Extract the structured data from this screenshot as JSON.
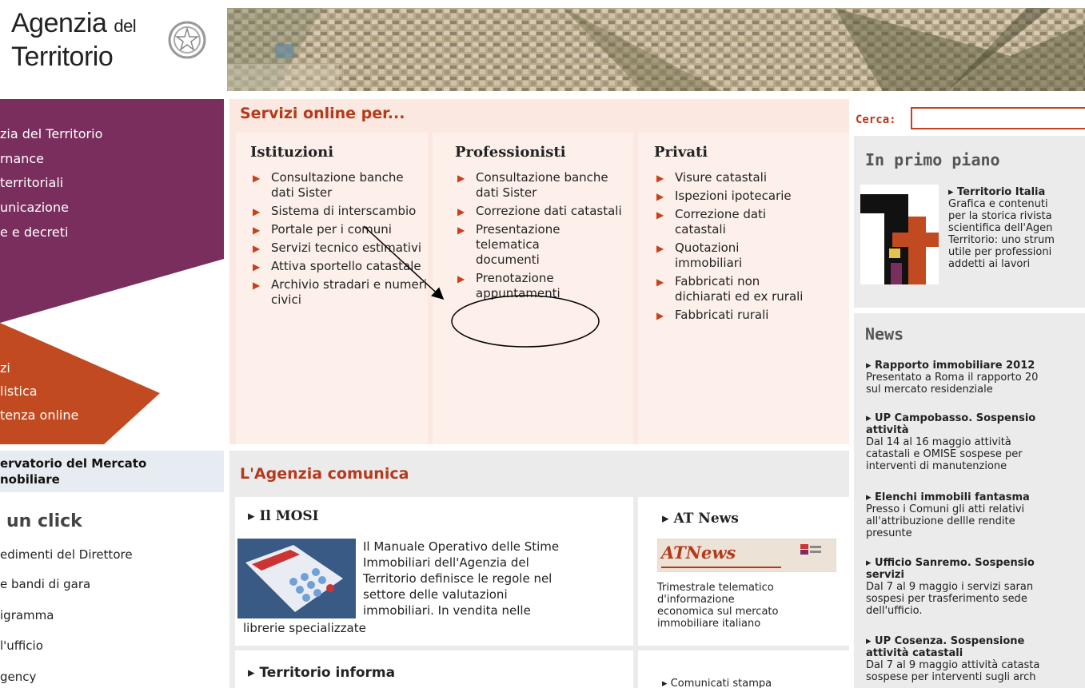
{
  "header": {
    "logo_line1": "Agenzia",
    "logo_del": "del",
    "logo_line2": "Territorio"
  },
  "left_nav": {
    "top_items": [
      "zia del Territorio",
      "rnance",
      "territoriali",
      "unicazione",
      "e e decreti"
    ],
    "bottom_items": [
      "zi",
      "listica",
      "tenza online"
    ],
    "osservatorio": [
      "ervatorio del Mercato",
      "nobiliare"
    ]
  },
  "un_click": {
    "title": "un click",
    "items": [
      "edimenti del Direttore",
      "e bandi di gara",
      "igramma",
      "l'ufficio",
      "gency"
    ]
  },
  "servizi": {
    "title": "Servizi online per...",
    "columns": [
      {
        "title": "Istituzioni",
        "items": [
          "Consultazione banche dati Sister",
          "Sistema di interscambio",
          "Portale per i comuni",
          "Servizi tecnico estimativi",
          "Attiva sportello catastale",
          "Archivio stradari e numeri civici"
        ]
      },
      {
        "title": "Professionisti",
        "items": [
          "Consultazione banche dati Sister",
          "Correzione dati catastali",
          "Presentazione telematica documenti",
          "Prenotazione appuntamenti"
        ]
      },
      {
        "title": "Privati",
        "items": [
          "Visure catastali",
          "Ispezioni ipotecarie",
          "Correzione dati catastali",
          "Quotazioni immobiliari",
          "Fabbricati non dichiarati ed ex rurali",
          "Fabbricati rurali"
        ]
      }
    ]
  },
  "comunica": {
    "title": "L'Agenzia comunica",
    "mosi_title": "▸ Il MOSI",
    "mosi_text_lines": [
      "Il Manuale Operativo delle Stime",
      "Immobiliari dell'Agenzia del",
      "Territorio definisce le regole nel",
      "settore delle valutazioni",
      "immobiliari. In vendita nelle"
    ],
    "mosi_text_last": "librerie specializzate",
    "atnews_title": "▸ AT News",
    "atnews_logo": "ATNews",
    "atnews_text": [
      "Trimestrale telematico",
      "d'informazione",
      "economica sul mercato",
      "immobiliare italiano"
    ],
    "territorio_title": "▸ Territorio informa",
    "comunicati": "▸ Comunicati stampa"
  },
  "search": {
    "label": "Cerca:",
    "value": ""
  },
  "primo_piano": {
    "title": "In primo piano",
    "item_title": "▸ Territorio Italia",
    "item_lines": [
      "Grafica e contenuti",
      "per la storica rivista",
      "scientifica dell'Agen",
      "Territorio: uno strum",
      "utile per professioni",
      "addetti ai lavori"
    ]
  },
  "news": {
    "title": "News",
    "items": [
      {
        "title": "▸ Rapporto immobiliare 2012",
        "lines": [
          "Presentato a Roma il rapporto 20",
          "sul mercato residenziale"
        ]
      },
      {
        "title": "▸ UP Campobasso. Sospensio",
        "title2": "attività",
        "lines": [
          "Dal 14 al 16 maggio attività",
          "catastali e OMISE sospese per",
          "interventi di manutenzione"
        ]
      },
      {
        "title": "▸ Elenchi immobili fantasma",
        "lines": [
          "Presso i Comuni gli atti relativi",
          "all'attribuzione dellle rendite",
          "presunte"
        ]
      },
      {
        "title": "▸ Ufficio Sanremo. Sospensio",
        "title2": "servizi",
        "lines": [
          "Dal 7 al 9 maggio i servizi saran",
          "sospesi per trasferimento sede",
          "dell'ufficio."
        ]
      },
      {
        "title": "▸ UP Cosenza. Sospensione",
        "title2": "attività catastali",
        "lines": [
          "Dal 7 al 9 maggio attività catasta",
          "sospese per interventi sugli arch"
        ]
      }
    ]
  },
  "colors": {
    "purple": "#7a2e5e",
    "orange": "#c24a20",
    "accent_red": "#b5391b",
    "peach": "#fbe8e0"
  }
}
